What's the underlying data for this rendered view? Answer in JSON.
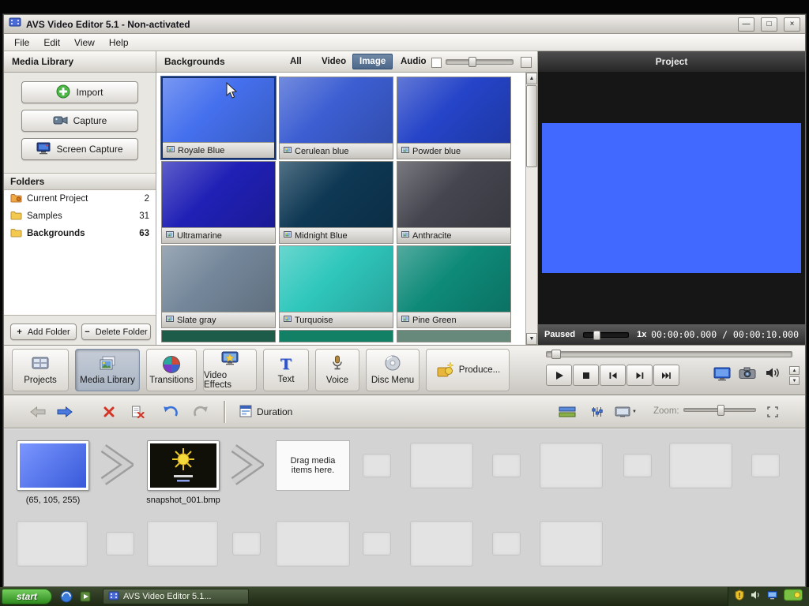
{
  "window": {
    "title": "AVS Video Editor 5.1 - Non-activated",
    "menu": [
      "File",
      "Edit",
      "View",
      "Help"
    ]
  },
  "icons": {
    "minimize": "—",
    "maximize": "□",
    "close": "×",
    "add": "+",
    "remove": "−",
    "scroll_up": "▲",
    "scroll_down": "▼",
    "spin_up": "▲",
    "spin_down": "▼",
    "dropdown": "▼",
    "text_tab": "T"
  },
  "library": {
    "title": "Media Library",
    "import_label": "Import",
    "capture_label": "Capture",
    "screen_capture_label": "Screen Capture",
    "folders_title": "Folders",
    "folders": [
      {
        "name": "Current Project",
        "count": "2",
        "selected": false
      },
      {
        "name": "Samples",
        "count": "31",
        "selected": false
      },
      {
        "name": "Backgrounds",
        "count": "63",
        "selected": true
      }
    ],
    "add_folder_label": "Add Folder",
    "delete_folder_label": "Delete Folder"
  },
  "browser": {
    "title": "Backgrounds",
    "filters": [
      {
        "label": "All",
        "selected": false
      },
      {
        "label": "Video",
        "selected": false
      },
      {
        "label": "Image",
        "selected": true
      },
      {
        "label": "Audio",
        "selected": false
      }
    ],
    "tiles": [
      {
        "name": "Royale Blue",
        "color": "#4570ee",
        "selected": true
      },
      {
        "name": "Cerulean blue",
        "color": "#3c5ed2",
        "selected": false
      },
      {
        "name": "Powder blue",
        "color": "#2544c8",
        "selected": false
      },
      {
        "name": "Ultramarine",
        "color": "#2020b6",
        "selected": false
      },
      {
        "name": "Midnight Blue",
        "color": "#0e3854",
        "selected": false
      },
      {
        "name": "Anthracite",
        "color": "#45454f",
        "selected": false
      },
      {
        "name": "Slate gray",
        "color": "#74879a",
        "selected": false
      },
      {
        "name": "Turquoise",
        "color": "#2fc7bc",
        "selected": false
      },
      {
        "name": "Pine Green",
        "color": "#0e8a79",
        "selected": false
      }
    ],
    "partial_tiles": [
      {
        "color": "#1d5c49"
      },
      {
        "color": "#128064"
      },
      {
        "color": "#67897b"
      }
    ]
  },
  "project": {
    "title": "Project",
    "status": "Paused",
    "speed": "1x",
    "timecode": "00:00:00.000 / 00:00:10.000",
    "preview_color": "#4169ff"
  },
  "tabs": [
    {
      "label": "Projects",
      "selected": false
    },
    {
      "label": "Media Library",
      "selected": true
    },
    {
      "label": "Transitions",
      "selected": false
    },
    {
      "label": "Video Effects",
      "selected": false
    },
    {
      "label": "Text",
      "selected": false
    },
    {
      "label": "Voice",
      "selected": false
    },
    {
      "label": "Disc Menu",
      "selected": false
    },
    {
      "label": "Produce...",
      "selected": false
    }
  ],
  "toolbar": {
    "duration_label": "Duration",
    "zoom_label": "Zoom:"
  },
  "storyboard": {
    "clip1_label": "(65, 105, 255)",
    "clip1_color": "#4169ff",
    "clip2_label": "snapshot_001.bmp",
    "drag_hint": "Drag media items here."
  },
  "taskbar": {
    "start_label": "start",
    "task_label": "AVS Video Editor 5.1..."
  }
}
